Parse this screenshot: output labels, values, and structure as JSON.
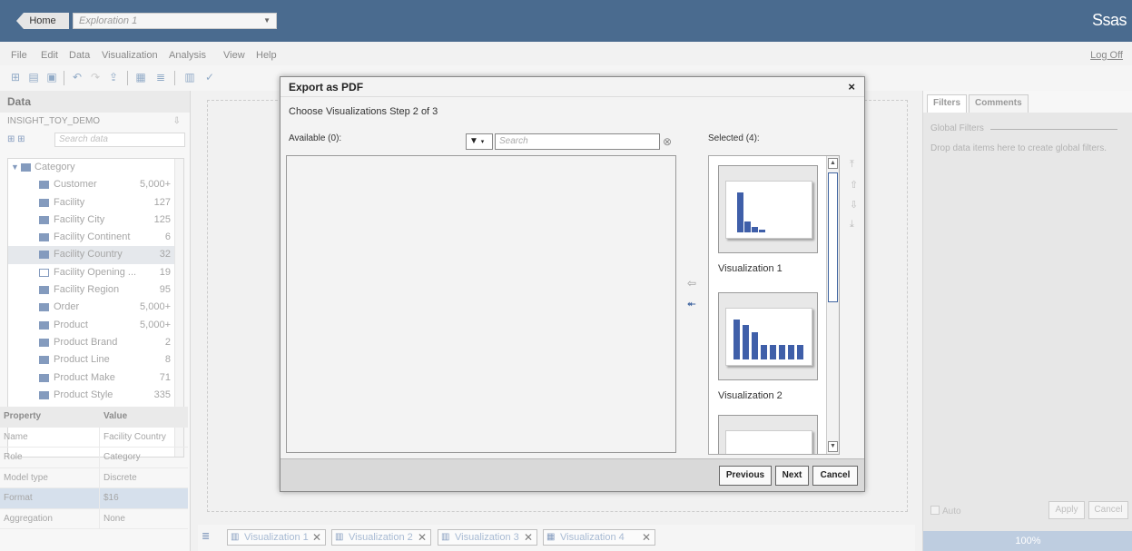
{
  "topbar": {
    "home_label": "Home",
    "exploration": "Exploration 1",
    "brand": "Ssas"
  },
  "menu": {
    "items": [
      "File",
      "Edit",
      "Data",
      "Visualization",
      "Analysis",
      "View",
      "Help"
    ],
    "logoff": "Log Off"
  },
  "data_panel": {
    "title": "Data",
    "data_source": "INSIGHT_TOY_DEMO",
    "search_placeholder": "Search data",
    "category_label": "Category",
    "items": [
      {
        "label": "Customer",
        "count": "5,000+"
      },
      {
        "label": "Facility",
        "count": "127"
      },
      {
        "label": "Facility City",
        "count": "125"
      },
      {
        "label": "Facility Continent",
        "count": "6"
      },
      {
        "label": "Facility Country",
        "count": "32"
      },
      {
        "label": "Facility Opening ...",
        "count": "19"
      },
      {
        "label": "Facility Region",
        "count": "95"
      },
      {
        "label": "Order",
        "count": "5,000+"
      },
      {
        "label": "Product",
        "count": "5,000+"
      },
      {
        "label": "Product Brand",
        "count": "2"
      },
      {
        "label": "Product Line",
        "count": "8"
      },
      {
        "label": "Product Make",
        "count": "71"
      },
      {
        "label": "Product Style",
        "count": "335"
      }
    ]
  },
  "properties": {
    "header_property": "Property",
    "header_value": "Value",
    "rows": [
      {
        "k": "Name",
        "v": "Facility Country"
      },
      {
        "k": "Role",
        "v": "Category"
      },
      {
        "k": "Model type",
        "v": "Discrete"
      },
      {
        "k": "Format",
        "v": "$16"
      },
      {
        "k": "Aggregation",
        "v": "None"
      }
    ]
  },
  "vis_tabs": [
    "Visualization 1",
    "Visualization 2",
    "Visualization 3",
    "Visualization 4"
  ],
  "right_panel": {
    "tab_filters": "Filters",
    "tab_comments": "Comments",
    "global_filters": "Global Filters",
    "drop_hint": "Drop data items here to create global filters.",
    "auto": "Auto",
    "apply": "Apply",
    "cancel": "Cancel",
    "zoom": "100%"
  },
  "dialog": {
    "title": "Export as PDF",
    "close": "×",
    "step": "Choose Visualizations   Step 2 of 3",
    "available_label": "Available (0):",
    "search_placeholder": "Search",
    "selected_label": "Selected (4):",
    "thumbnails": [
      {
        "label": "Visualization 1"
      },
      {
        "label": "Visualization 2"
      }
    ],
    "previous": "Previous",
    "next": "Next",
    "cancel": "Cancel"
  }
}
